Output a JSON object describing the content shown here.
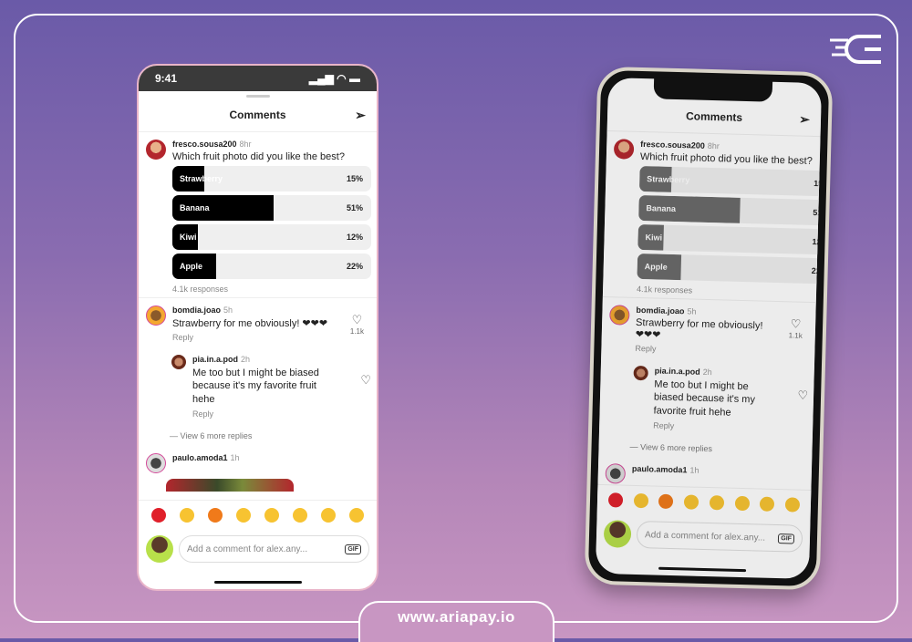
{
  "brand": {
    "url": "www.ariapay.io",
    "logo": "ariapay-logo"
  },
  "status": {
    "time": "9:41",
    "icons": "signal-wifi-battery"
  },
  "header": {
    "title": "Comments",
    "send_icon": "paper-plane-icon"
  },
  "post": {
    "user": "fresco.sousa200",
    "time": "8hr",
    "question": "Which fruit photo did you like the best?",
    "options": [
      {
        "label": "Strawberry",
        "emoji": "strawberry",
        "percent": 15
      },
      {
        "label": "Banana",
        "emoji": "banana",
        "percent": 51
      },
      {
        "label": "Kiwi",
        "emoji": "kiwi",
        "percent": 12
      },
      {
        "label": "Apple",
        "emoji": "apple",
        "percent": 22
      }
    ],
    "responses": "4.1k responses"
  },
  "comments": [
    {
      "user": "bomdia.joao",
      "time": "5h",
      "text": "Strawberry for me obviously! ❤❤❤",
      "reply": "Reply",
      "likes": "1.1k"
    },
    {
      "user": "pia.in.a.pod",
      "time": "2h",
      "text": "Me too but I might be biased because it's my favorite fruit hehe",
      "reply": "Reply"
    },
    {
      "user": "paulo.amoda1",
      "time": "1h"
    }
  ],
  "view_more": "View 6 more replies",
  "reactions": [
    "heart",
    "raised-hands",
    "fire",
    "clapping",
    "crying",
    "heart-eyes",
    "surprised",
    "laughing"
  ],
  "input": {
    "placeholder": "Add a comment for alex.any...",
    "gif": "GIF"
  },
  "colors": {
    "bar_fill_left": "#000000",
    "bar_fill_right": "#6b6b6b",
    "bg_top": "#6a5aa8",
    "bg_bottom": "#c896c2"
  }
}
